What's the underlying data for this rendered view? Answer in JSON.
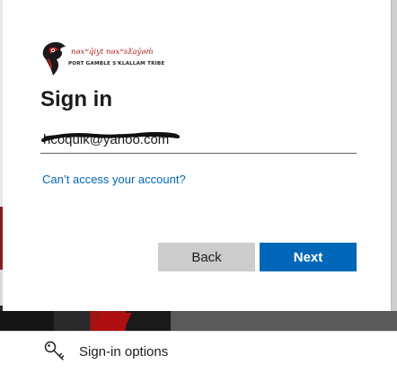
{
  "logo": {
    "native_name": "nəxʷq̓iyt nəxʷsƛ̕ay̓əm̓",
    "tribe_name": "PORT GAMBLE S'KLALLAM TRIBE"
  },
  "title": "Sign in",
  "email": {
    "value": "hcoquik@yahoo.com"
  },
  "help_link": "Can’t access your account?",
  "buttons": {
    "back": "Back",
    "next": "Next"
  },
  "sign_in_options": {
    "label": "Sign-in options",
    "icon": "key-icon"
  },
  "colors": {
    "accent": "#0067b8",
    "back_button": "#cccccc",
    "logo_red": "#b01c1c"
  }
}
